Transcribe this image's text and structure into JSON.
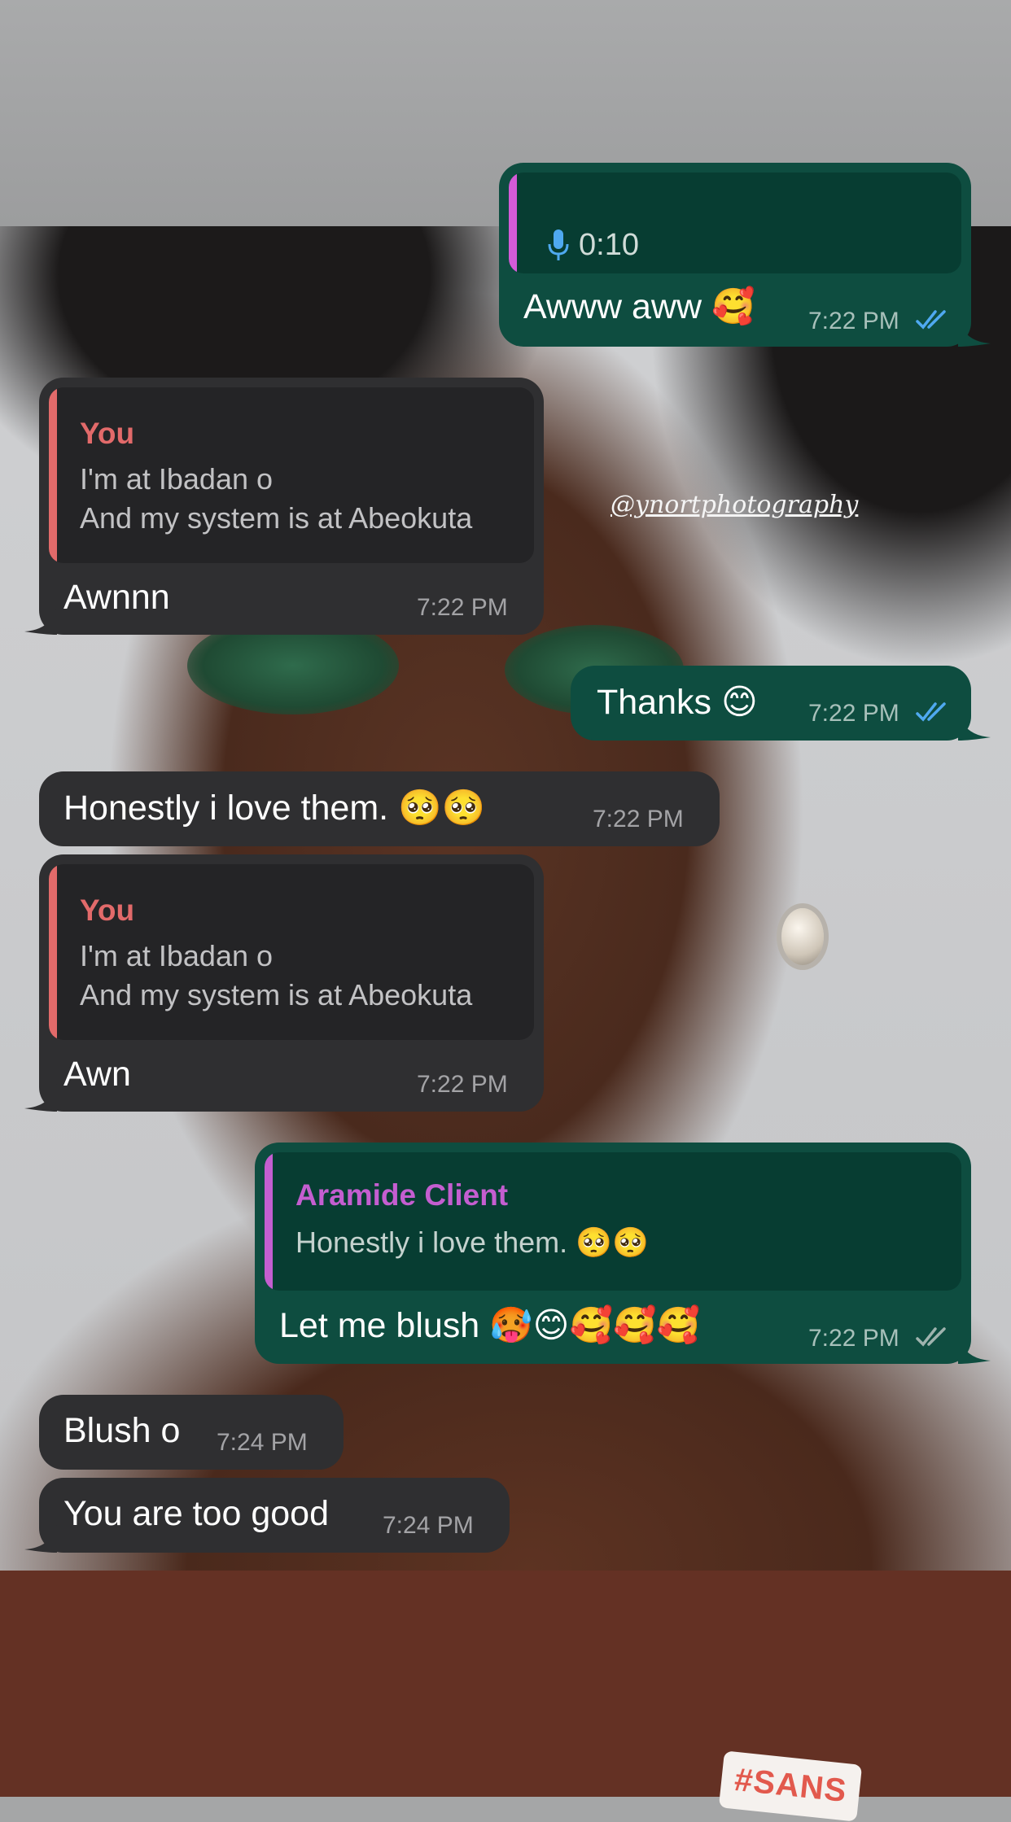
{
  "watermark": "@ynortphotography",
  "sticker_text": "#SANS",
  "messages": [
    {
      "direction": "out",
      "voice_duration": "0:10",
      "text": "Awww aww 🥰",
      "time": "7:22 PM",
      "status": "read"
    },
    {
      "direction": "in",
      "quote": {
        "author": "You",
        "line1": "I'm at Ibadan o",
        "line2": "And my system is at Abeokuta"
      },
      "text": "Awnnn",
      "time": "7:22 PM"
    },
    {
      "direction": "out",
      "text": "Thanks 😊",
      "time": "7:22 PM",
      "status": "read"
    },
    {
      "direction": "in",
      "text": "Honestly i love them. 🥺🥺",
      "time": "7:22 PM"
    },
    {
      "direction": "in",
      "quote": {
        "author": "You",
        "line1": "I'm at Ibadan o",
        "line2": "And my system is at Abeokuta"
      },
      "text": "Awn",
      "time": "7:22 PM"
    },
    {
      "direction": "out",
      "quote": {
        "author": "Aramide Client",
        "line1": "Honestly i love them. 🥺🥺"
      },
      "text": "Let me blush 🥵😊🥰🥰🥰",
      "time": "7:22 PM",
      "status": "delivered"
    },
    {
      "direction": "in",
      "text": "Blush o",
      "time": "7:24 PM"
    },
    {
      "direction": "in",
      "text": "You are too good",
      "time": "7:24 PM"
    }
  ],
  "colors": {
    "incoming_bubble": "#2f2f31",
    "outgoing_bubble": "#0e4d40",
    "quote_you": "#e26a6a",
    "quote_client": "#c45ed0",
    "voice_bar": "#d45bd8",
    "read_ticks": "#4fa9f0",
    "delivered_ticks": "#9fb3ae"
  },
  "icons": {
    "voice": "microphone-icon",
    "read": "double-check-blue-icon",
    "delivered": "double-check-gray-icon"
  }
}
